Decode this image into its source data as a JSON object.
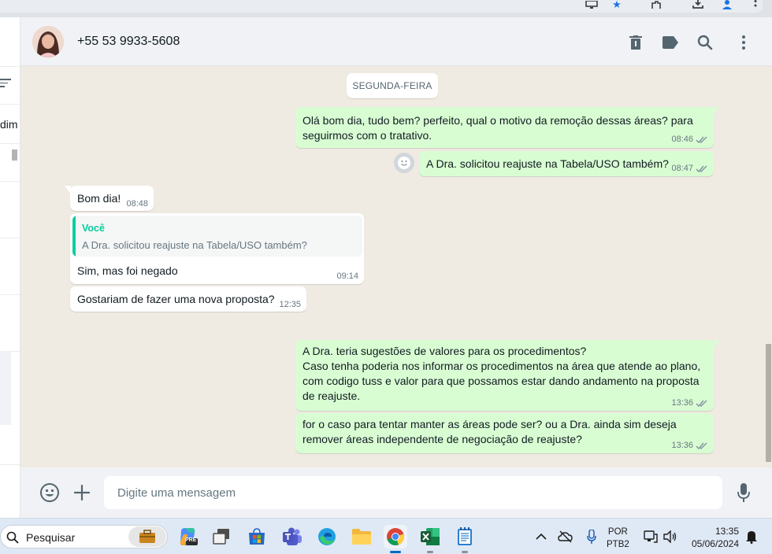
{
  "contact": {
    "phone": "+55 53 9933-5608"
  },
  "left_panel": {
    "truncated_text": "dim"
  },
  "chat": {
    "date_divider": "SEGUNDA-FEIRA",
    "messages": [
      {
        "direction": "out",
        "text": "Olá bom dia, tudo bem? perfeito, qual o motivo da remoção dessas áreas? para\nseguirmos com o tratativo.",
        "time": "08:46",
        "status": "read"
      },
      {
        "direction": "out",
        "text": "A Dra. solicitou reajuste na Tabela/USO também?",
        "time": "08:47",
        "status": "read"
      },
      {
        "direction": "in",
        "text": "Bom dia!",
        "time": "08:48"
      },
      {
        "direction": "in",
        "quote": {
          "author": "Você",
          "text": "A Dra. solicitou reajuste na Tabela/USO também?"
        },
        "text": "Sim, mas foi negado",
        "time": "09:14"
      },
      {
        "direction": "in",
        "text": "Gostariam de fazer uma nova proposta?",
        "time": "12:35"
      },
      {
        "direction": "out",
        "text": "A Dra. teria sugestões de valores para os procedimentos?\nCaso tenha poderia nos informar os procedimentos na área que atende ao plano,\ncom codigo tuss e valor para que possamos estar dando andamento na proposta\nde reajuste.",
        "time": "13:36",
        "status": "read"
      },
      {
        "direction": "out",
        "text": "for o caso para tentar manter as áreas pode ser? ou a Dra. ainda sim deseja\nremover áreas independente de negociação de reajuste?",
        "time": "13:36",
        "status": "read"
      }
    ]
  },
  "composer": {
    "placeholder": "Digite uma mensagem"
  },
  "taskbar": {
    "search_placeholder": "Pesquisar",
    "apps": [
      "briefcase",
      "copilot",
      "task-view",
      "microsoft-store",
      "teams",
      "edge",
      "file-explorer",
      "chrome",
      "excel",
      "notepad"
    ],
    "active_app": "chrome",
    "lang_line1": "POR",
    "lang_line2": "PTB2",
    "time": "13:35",
    "date": "05/06/2024",
    "copilot_badge": "PRE"
  },
  "colors": {
    "outgoing_bubble": "#d9fdd3",
    "incoming_bubble": "#ffffff",
    "chat_background": "#efeae2",
    "panel_background": "#f0f2f5",
    "read_ticks": "#8696a0",
    "quote_accent": "#06cf9c"
  }
}
